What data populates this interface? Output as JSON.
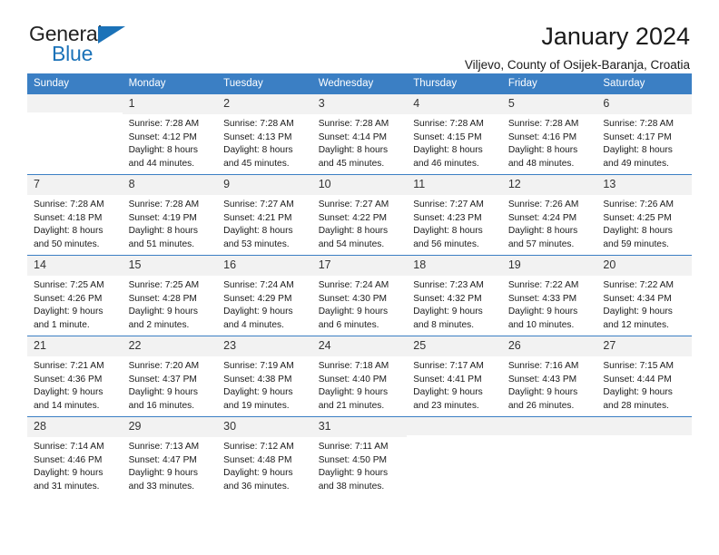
{
  "logo": {
    "word_one": "General",
    "word_two": "Blue",
    "accent_color": "#1b72b8"
  },
  "header": {
    "title": "January 2024",
    "subtitle": "Viljevo, County of Osijek-Baranja, Croatia",
    "header_bg_color": "#3b7fc4"
  },
  "calendar": {
    "weekday_headers": [
      "Sunday",
      "Monday",
      "Tuesday",
      "Wednesday",
      "Thursday",
      "Friday",
      "Saturday"
    ],
    "weeks": [
      [
        {
          "day": "",
          "lines": []
        },
        {
          "day": "1",
          "lines": [
            "Sunrise: 7:28 AM",
            "Sunset: 4:12 PM",
            "Daylight: 8 hours",
            "and 44 minutes."
          ]
        },
        {
          "day": "2",
          "lines": [
            "Sunrise: 7:28 AM",
            "Sunset: 4:13 PM",
            "Daylight: 8 hours",
            "and 45 minutes."
          ]
        },
        {
          "day": "3",
          "lines": [
            "Sunrise: 7:28 AM",
            "Sunset: 4:14 PM",
            "Daylight: 8 hours",
            "and 45 minutes."
          ]
        },
        {
          "day": "4",
          "lines": [
            "Sunrise: 7:28 AM",
            "Sunset: 4:15 PM",
            "Daylight: 8 hours",
            "and 46 minutes."
          ]
        },
        {
          "day": "5",
          "lines": [
            "Sunrise: 7:28 AM",
            "Sunset: 4:16 PM",
            "Daylight: 8 hours",
            "and 48 minutes."
          ]
        },
        {
          "day": "6",
          "lines": [
            "Sunrise: 7:28 AM",
            "Sunset: 4:17 PM",
            "Daylight: 8 hours",
            "and 49 minutes."
          ]
        }
      ],
      [
        {
          "day": "7",
          "lines": [
            "Sunrise: 7:28 AM",
            "Sunset: 4:18 PM",
            "Daylight: 8 hours",
            "and 50 minutes."
          ]
        },
        {
          "day": "8",
          "lines": [
            "Sunrise: 7:28 AM",
            "Sunset: 4:19 PM",
            "Daylight: 8 hours",
            "and 51 minutes."
          ]
        },
        {
          "day": "9",
          "lines": [
            "Sunrise: 7:27 AM",
            "Sunset: 4:21 PM",
            "Daylight: 8 hours",
            "and 53 minutes."
          ]
        },
        {
          "day": "10",
          "lines": [
            "Sunrise: 7:27 AM",
            "Sunset: 4:22 PM",
            "Daylight: 8 hours",
            "and 54 minutes."
          ]
        },
        {
          "day": "11",
          "lines": [
            "Sunrise: 7:27 AM",
            "Sunset: 4:23 PM",
            "Daylight: 8 hours",
            "and 56 minutes."
          ]
        },
        {
          "day": "12",
          "lines": [
            "Sunrise: 7:26 AM",
            "Sunset: 4:24 PM",
            "Daylight: 8 hours",
            "and 57 minutes."
          ]
        },
        {
          "day": "13",
          "lines": [
            "Sunrise: 7:26 AM",
            "Sunset: 4:25 PM",
            "Daylight: 8 hours",
            "and 59 minutes."
          ]
        }
      ],
      [
        {
          "day": "14",
          "lines": [
            "Sunrise: 7:25 AM",
            "Sunset: 4:26 PM",
            "Daylight: 9 hours",
            "and 1 minute."
          ]
        },
        {
          "day": "15",
          "lines": [
            "Sunrise: 7:25 AM",
            "Sunset: 4:28 PM",
            "Daylight: 9 hours",
            "and 2 minutes."
          ]
        },
        {
          "day": "16",
          "lines": [
            "Sunrise: 7:24 AM",
            "Sunset: 4:29 PM",
            "Daylight: 9 hours",
            "and 4 minutes."
          ]
        },
        {
          "day": "17",
          "lines": [
            "Sunrise: 7:24 AM",
            "Sunset: 4:30 PM",
            "Daylight: 9 hours",
            "and 6 minutes."
          ]
        },
        {
          "day": "18",
          "lines": [
            "Sunrise: 7:23 AM",
            "Sunset: 4:32 PM",
            "Daylight: 9 hours",
            "and 8 minutes."
          ]
        },
        {
          "day": "19",
          "lines": [
            "Sunrise: 7:22 AM",
            "Sunset: 4:33 PM",
            "Daylight: 9 hours",
            "and 10 minutes."
          ]
        },
        {
          "day": "20",
          "lines": [
            "Sunrise: 7:22 AM",
            "Sunset: 4:34 PM",
            "Daylight: 9 hours",
            "and 12 minutes."
          ]
        }
      ],
      [
        {
          "day": "21",
          "lines": [
            "Sunrise: 7:21 AM",
            "Sunset: 4:36 PM",
            "Daylight: 9 hours",
            "and 14 minutes."
          ]
        },
        {
          "day": "22",
          "lines": [
            "Sunrise: 7:20 AM",
            "Sunset: 4:37 PM",
            "Daylight: 9 hours",
            "and 16 minutes."
          ]
        },
        {
          "day": "23",
          "lines": [
            "Sunrise: 7:19 AM",
            "Sunset: 4:38 PM",
            "Daylight: 9 hours",
            "and 19 minutes."
          ]
        },
        {
          "day": "24",
          "lines": [
            "Sunrise: 7:18 AM",
            "Sunset: 4:40 PM",
            "Daylight: 9 hours",
            "and 21 minutes."
          ]
        },
        {
          "day": "25",
          "lines": [
            "Sunrise: 7:17 AM",
            "Sunset: 4:41 PM",
            "Daylight: 9 hours",
            "and 23 minutes."
          ]
        },
        {
          "day": "26",
          "lines": [
            "Sunrise: 7:16 AM",
            "Sunset: 4:43 PM",
            "Daylight: 9 hours",
            "and 26 minutes."
          ]
        },
        {
          "day": "27",
          "lines": [
            "Sunrise: 7:15 AM",
            "Sunset: 4:44 PM",
            "Daylight: 9 hours",
            "and 28 minutes."
          ]
        }
      ],
      [
        {
          "day": "28",
          "lines": [
            "Sunrise: 7:14 AM",
            "Sunset: 4:46 PM",
            "Daylight: 9 hours",
            "and 31 minutes."
          ]
        },
        {
          "day": "29",
          "lines": [
            "Sunrise: 7:13 AM",
            "Sunset: 4:47 PM",
            "Daylight: 9 hours",
            "and 33 minutes."
          ]
        },
        {
          "day": "30",
          "lines": [
            "Sunrise: 7:12 AM",
            "Sunset: 4:48 PM",
            "Daylight: 9 hours",
            "and 36 minutes."
          ]
        },
        {
          "day": "31",
          "lines": [
            "Sunrise: 7:11 AM",
            "Sunset: 4:50 PM",
            "Daylight: 9 hours",
            "and 38 minutes."
          ]
        },
        {
          "day": "",
          "lines": []
        },
        {
          "day": "",
          "lines": []
        },
        {
          "day": "",
          "lines": []
        }
      ]
    ]
  }
}
